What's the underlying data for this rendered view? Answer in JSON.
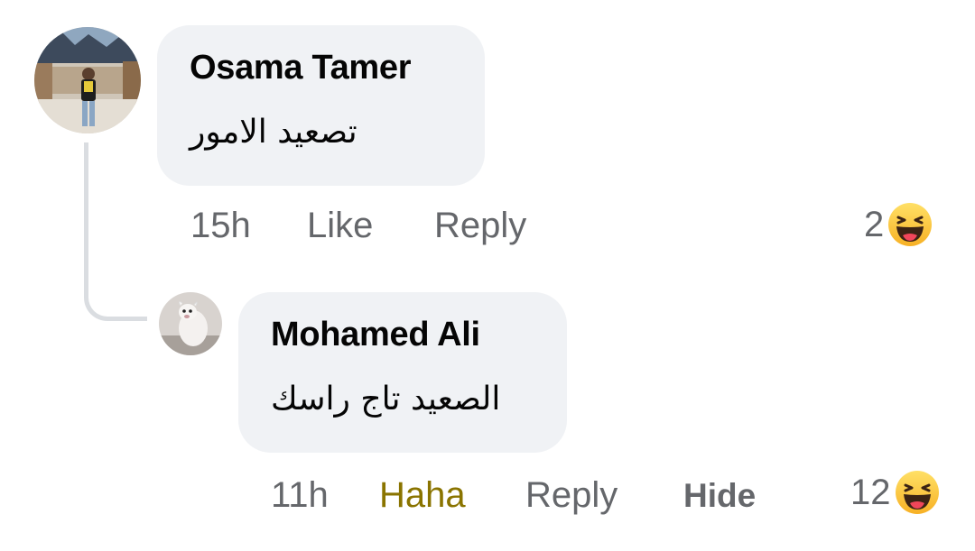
{
  "comments": [
    {
      "author": "Osama Tamer",
      "text": "تصعيد الامور",
      "time": "15h",
      "actions": {
        "like": "Like",
        "reply": "Reply"
      },
      "reaction_count": "2",
      "reaction_icon": "haha-icon"
    },
    {
      "author": "Mohamed Ali",
      "text": "الصعيد تاج راسك",
      "time": "11h",
      "actions": {
        "reaction": "Haha",
        "reply": "Reply",
        "hide": "Hide"
      },
      "reaction_count": "12",
      "reaction_icon": "haha-icon"
    }
  ],
  "colors": {
    "bubble": "#f0f2f5",
    "meta_text": "#65676b",
    "haha_active": "#8a7400",
    "thread_line": "#dadde1"
  }
}
